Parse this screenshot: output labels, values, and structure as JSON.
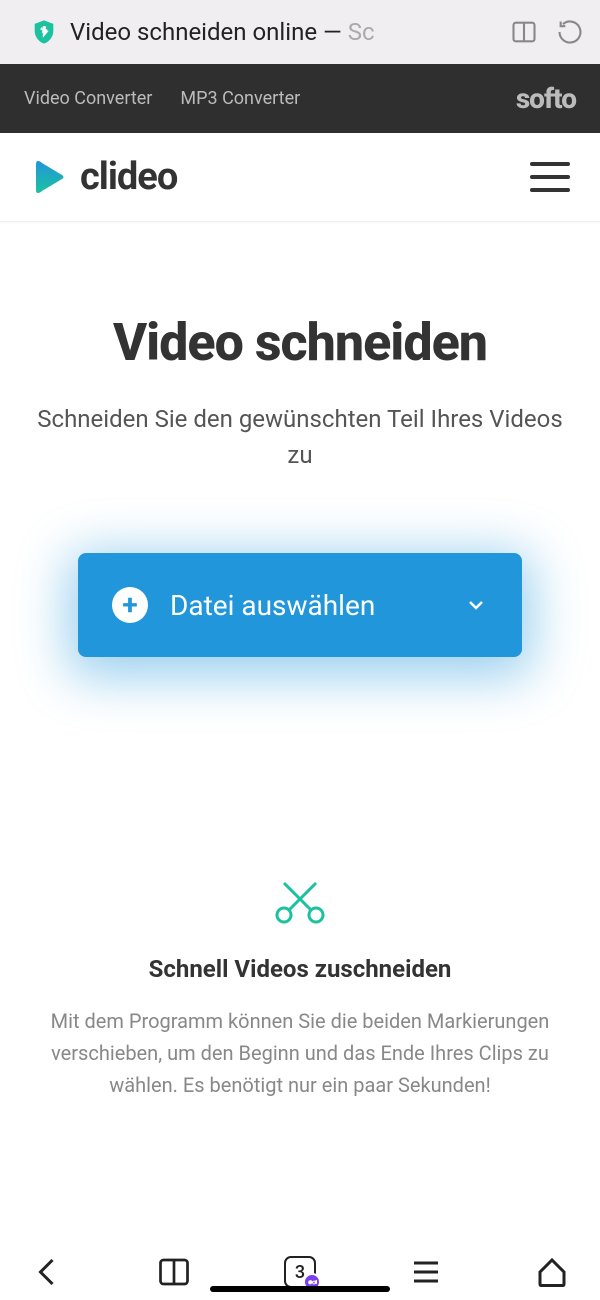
{
  "browser": {
    "page_title_main": "Video schneiden online — ",
    "page_title_faded": "Sc"
  },
  "dark_nav": {
    "links": [
      "Video Converter",
      "MP3 Converter"
    ],
    "brand": "softo"
  },
  "header": {
    "brand": "clideo"
  },
  "hero": {
    "title": "Video schneiden",
    "subtitle": "Schneiden Sie den gewünschten Teil Ihres Videos zu"
  },
  "upload": {
    "label": "Datei auswählen"
  },
  "feature": {
    "title": "Schnell Videos zuschneiden",
    "text": "Mit dem Programm können Sie die beiden Markierungen verschieben, um den Beginn und das Ende Ihres Clips zu wählen. Es benötigt nur ein paar Sekunden!"
  },
  "bottom_nav": {
    "tab_count": "3"
  }
}
